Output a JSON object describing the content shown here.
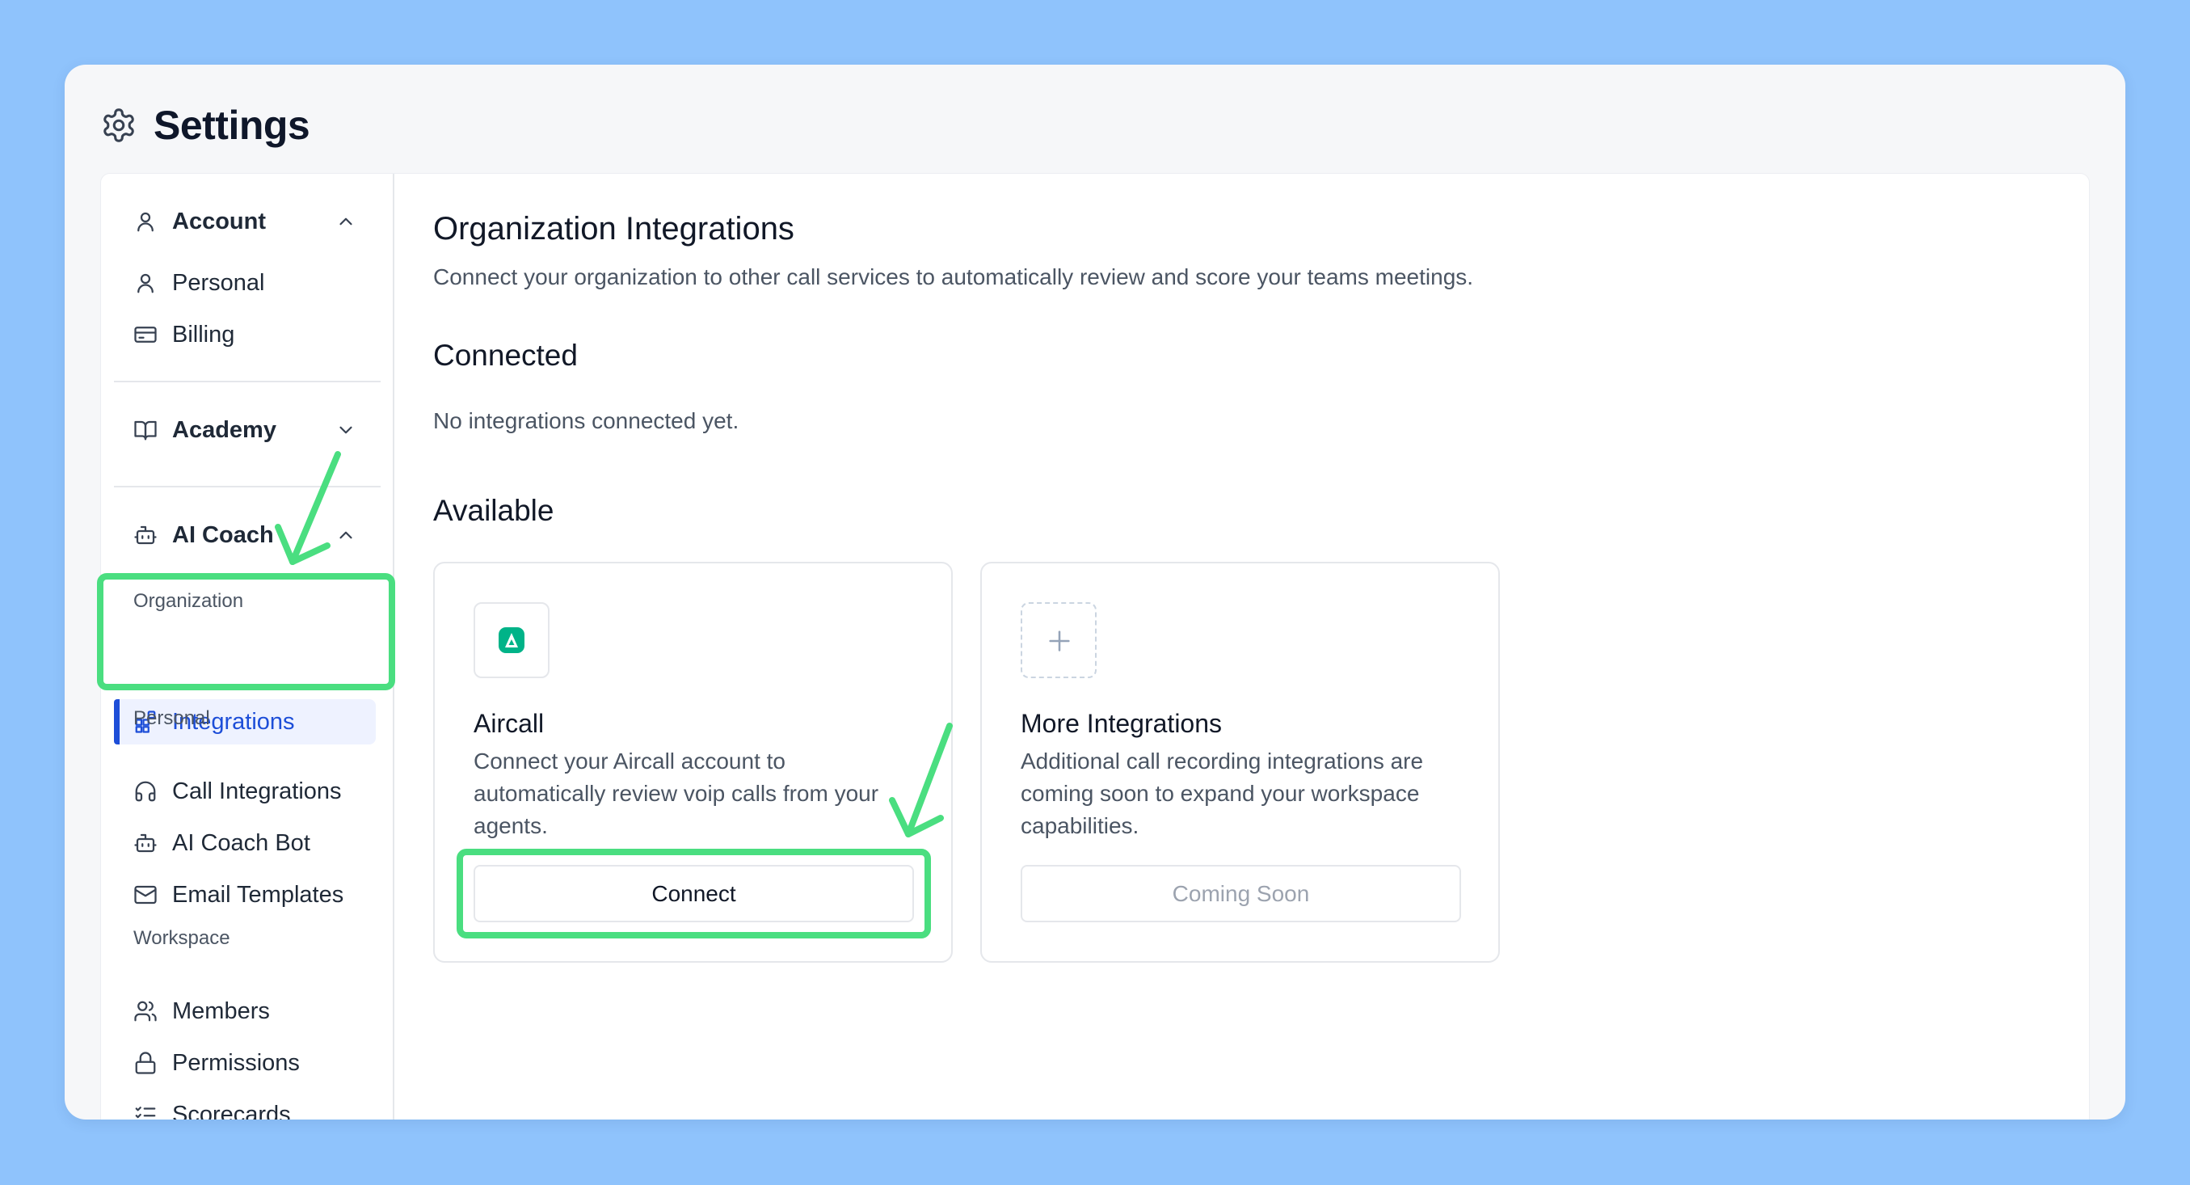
{
  "header": {
    "title": "Settings",
    "icon": "gear-icon"
  },
  "sidebar": {
    "account": {
      "label": "Account",
      "items": [
        {
          "label": "Personal",
          "icon": "user-icon"
        },
        {
          "label": "Billing",
          "icon": "credit-card-icon"
        }
      ]
    },
    "academy": {
      "label": "Academy"
    },
    "ai_coach": {
      "label": "AI Coach",
      "sections": [
        {
          "label": "Organization",
          "items": [
            {
              "label": "Integrations",
              "icon": "grid-plus-icon",
              "active": true
            }
          ]
        },
        {
          "label": "Personal",
          "items": [
            {
              "label": "Call Integrations",
              "icon": "headset-icon"
            },
            {
              "label": "AI Coach Bot",
              "icon": "bot-icon"
            },
            {
              "label": "Email Templates",
              "icon": "mail-icon"
            }
          ]
        },
        {
          "label": "Workspace",
          "items": [
            {
              "label": "Members",
              "icon": "users-icon"
            },
            {
              "label": "Permissions",
              "icon": "lock-icon"
            },
            {
              "label": "Scorecards",
              "icon": "checklist-icon"
            }
          ]
        }
      ]
    }
  },
  "main": {
    "title": "Organization Integrations",
    "subtitle": "Connect your organization to other call services to automatically review and score your teams meetings.",
    "connected": {
      "heading": "Connected",
      "empty_text": "No integrations connected yet."
    },
    "available": {
      "heading": "Available",
      "cards": [
        {
          "title": "Aircall",
          "description": "Connect your Aircall account to automatically review voip calls from your agents.",
          "button": "Connect"
        },
        {
          "title": "More Integrations",
          "description": "Additional call recording integrations are coming soon to expand your workspace capabilities.",
          "button": "Coming Soon"
        }
      ]
    }
  },
  "colors": {
    "accent": "#1d4ed8",
    "annotation": "#4ade80",
    "background": "#8fc3fc",
    "aircall": "#00b388"
  }
}
